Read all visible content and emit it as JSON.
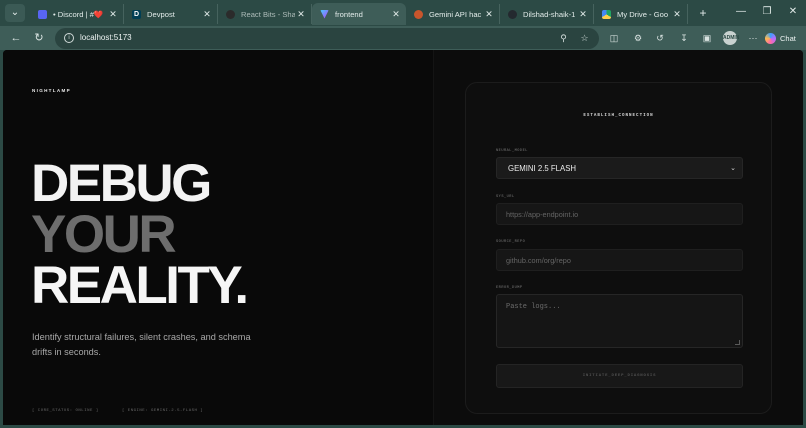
{
  "browser": {
    "tabs": [
      {
        "title": "• Discord | #❤️",
        "favicon_color": "#5865f2",
        "favicon_glyph": "",
        "active": false
      },
      {
        "title": "Devpost",
        "favicon_color": "#003e54",
        "favicon_glyph": "D",
        "active": false
      },
      {
        "title": "React Bits - Sha",
        "favicon_color": "#2b2b2b",
        "favicon_glyph": "",
        "active": false
      },
      {
        "title": "frontend",
        "favicon_color": "#8e4dff",
        "favicon_glyph": "",
        "active": true
      },
      {
        "title": "Gemini API hac",
        "favicon_color": "#c8552c",
        "favicon_glyph": "",
        "active": false
      },
      {
        "title": "Dilshad-shaik-1",
        "favicon_color": "#24292f",
        "favicon_glyph": "",
        "active": false
      },
      {
        "title": "My Drive - Goo",
        "favicon_color": "#1fa463",
        "favicon_glyph": "",
        "active": false
      }
    ],
    "url": "localhost:5173",
    "chat_label": "Chat",
    "profile_initials": "ADMIN"
  },
  "hero": {
    "brand": "NIGHTLAMP",
    "headline": [
      "DEBUG",
      "YOUR",
      "REALITY."
    ],
    "subtitle": "Identify structural failures, silent crashes, and schema drifts in seconds.",
    "status_left": "[ CORE_STATUS: ONLINE ]",
    "status_right": "[ ENGINE: GEMINI-2.5-FLASH ]"
  },
  "form": {
    "title": "ESTABLISH_CONNECTION",
    "model_label": "NEURAL_MODEL",
    "model_value": "GEMINI 2.5 FLASH",
    "url_label": "SYS_URL",
    "url_placeholder": "https://app-endpoint.io",
    "repo_label": "SOURCE_REPO",
    "repo_placeholder": "github.com/org/repo",
    "logs_label": "ERROR_DUMP",
    "logs_placeholder": "Paste logs...",
    "submit_label": "INITIATE_DEEP_DIAGNOSIS"
  },
  "colors": {
    "chrome": "#2c4a45",
    "page_bg": "#080808",
    "headline_primary": "#f3f3f3",
    "headline_muted": "#6d6d6d"
  }
}
